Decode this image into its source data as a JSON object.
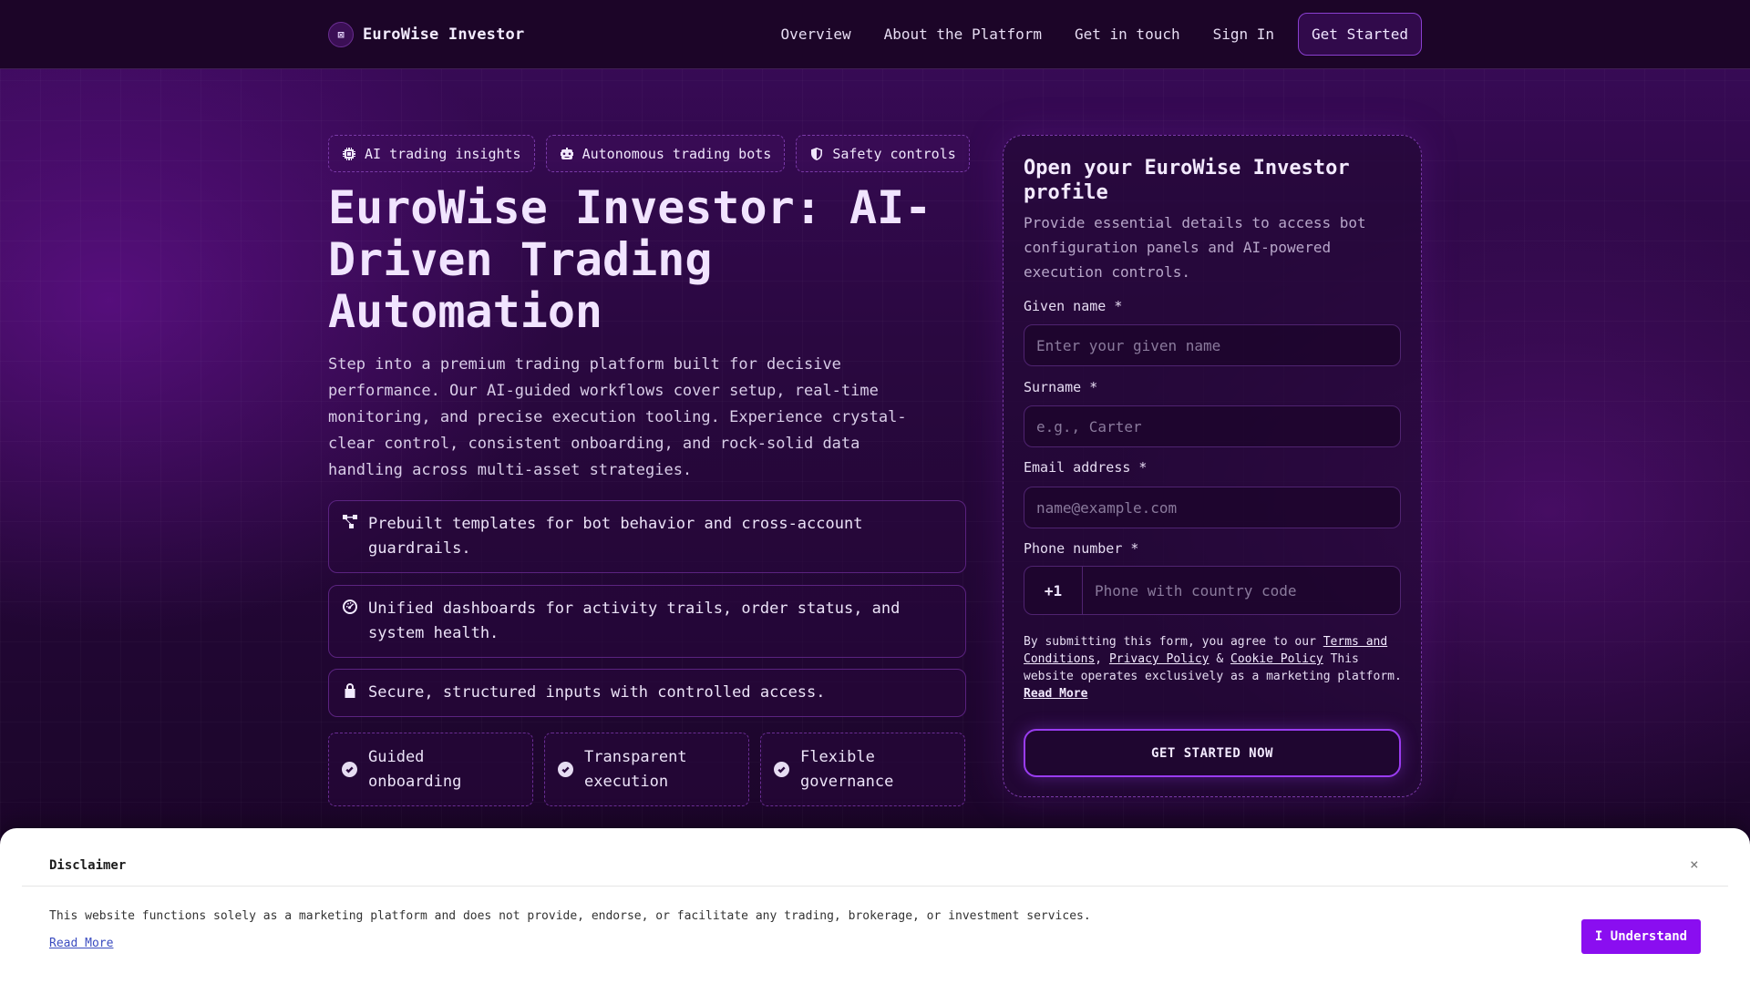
{
  "nav": {
    "brand_logo_char": "⊠",
    "brand": "EuroWise Investor",
    "links": [
      "Overview",
      "About the Platform",
      "Get in touch",
      "Sign In"
    ],
    "cta": "Get Started"
  },
  "hero": {
    "chips": [
      {
        "label": "AI trading insights",
        "icon": "chip-icon"
      },
      {
        "label": "Autonomous trading bots",
        "icon": "robot-icon"
      },
      {
        "label": "Safety controls",
        "icon": "shield-icon"
      }
    ],
    "title": "EuroWise Investor: AI-Driven Trading Automation",
    "description": "Step into a premium trading platform built for decisive performance. Our AI-guided workflows cover setup, real-time monitoring, and precise execution tooling. Experience crystal-clear control, consistent onboarding, and rock-solid data handling across multi-asset strategies.",
    "features": [
      {
        "text": "Prebuilt templates for bot behavior and cross-account guardrails.",
        "icon": "nodes-icon"
      },
      {
        "text": "Unified dashboards for activity trails, order status, and system health.",
        "icon": "dashboard-icon"
      },
      {
        "text": "Secure, structured inputs with controlled access.",
        "icon": "lock-icon"
      }
    ],
    "highlights": [
      "Guided onboarding",
      "Transparent execution",
      "Flexible governance"
    ]
  },
  "form": {
    "title": "Open your EuroWise Investor profile",
    "subtitle": "Provide essential details to access bot configuration panels and AI-powered execution controls.",
    "given_name_label": "Given name *",
    "given_name_placeholder": "Enter your given name",
    "surname_label": "Surname *",
    "surname_placeholder": "e.g., Carter",
    "email_label": "Email address *",
    "email_placeholder": "name@example.com",
    "phone_label": "Phone number *",
    "phone_code": "+1",
    "phone_placeholder": "Phone with country code",
    "legal_prefix": "By submitting this form, you agree to our ",
    "terms_link": "Terms and Conditions",
    "privacy_link": "Privacy Policy",
    "cookie_link": "Cookie Policy",
    "legal_suffix": " This website operates exclusively as a marketing platform. ",
    "read_more": "Read More",
    "submit": "GET STARTED NOW"
  },
  "disclaimer": {
    "title": "Disclaimer",
    "close": "×",
    "text": "This website functions solely as a marketing platform and does not provide, endorse, or facilitate any trading, brokerage, or investment services.",
    "read_more": "Read More",
    "button": "I Understand"
  },
  "colors": {
    "accent": "#8a0ef0",
    "background": "#1a0526",
    "card_border": "#7a3aa8"
  }
}
